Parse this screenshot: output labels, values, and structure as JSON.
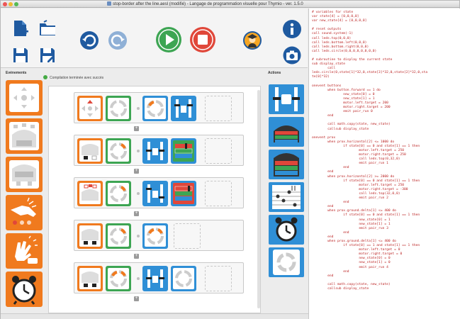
{
  "window": {
    "title": "stop-border after the line.aesl (modifié) - Langage de programmation visuelle pour Thymio - ver. 1.5.0"
  },
  "toolbar": {
    "icons": [
      "new-file-icon",
      "open-folder-icon",
      "save-icon",
      "save-as-icon",
      "undo-icon",
      "redo-icon",
      "run-icon",
      "stop-icon",
      "advanced-mode-icon",
      "info-icon",
      "screenshot-icon"
    ]
  },
  "events_panel": {
    "title": "Evénements",
    "items": [
      "buttons-event",
      "proximity-event",
      "ground-event",
      "tap-event",
      "clap-event",
      "timer-event"
    ]
  },
  "actions_panel": {
    "title": "Actions",
    "items": [
      "motors-action",
      "top-color-action",
      "bottom-color-action",
      "music-action",
      "timer-action",
      "state-action"
    ]
  },
  "status": {
    "text": "Compilation terminée avec succès"
  },
  "colors": {
    "orange": "#f07a1e",
    "blue": "#2f8fd6",
    "green": "#3da553",
    "red": "#e0473a",
    "code_red": "#b22222"
  },
  "code": {
    "text": "# variables for state\nvar state[4] = [0,0,0,0]\nvar new_state[4] = [0,0,0,0]\n\n# reset outputs\ncall sound.system(-1)\ncall leds.top(0,0,0)\ncall leds.bottom.left(0,0,0)\ncall leds.bottom.right(0,0,0)\ncall leds.circle(0,0,0,0,0,0,0,0)\n\n# subroutine to display the current state\nsub display_state\n\tcall\nleds.circle(0,state[1]*32,0,state[3]*32,0,state[2]*32,0,sta\nte[0]*32)\n\nonevent buttons\n\twhen button.forward == 1 do\n\t\tnew_state[0] = 0\n\t\tnew_state[1] = 1\n\t\tmotor.left.target = 200\n\t\tmotor.right.target = 200\n\t\temit pair_run 0\n\tend\n\n\tcall math.copy(state, new_state)\n\tcallsub display_state\n\nonevent prox\n\twhen prox.horizontal[2] <= 1000 do\n\t\tif state[0] == 0 and state[1] == 1 then\n\t\t\tmotor.left.target = 250\n\t\t\tmotor.right.target = 250\n\t\t\tcall leds.top(0,32,0)\n\t\t\temit pair_run 1\n\t\tend\n\tend\n\twhen prox.horizontal[2] >= 2000 do\n\t\tif state[0] == 0 and state[1] == 1 then\n\t\t\tmotor.left.target = 250\n\t\t\tmotor.right.target = -300\n\t\t\tcall leds.top(32,0,0)\n\t\t\temit pair_run 2\n\t\tend\n\tend\n\twhen prox.ground.delta[1] <= 400 do\n\t\tif state[0] == 0 and state[1] == 1 then\n\t\t\tnew_state[0] = 1\n\t\t\tnew_state[1] = 1\n\t\t\temit pair_run 3\n\t\tend\n\tend\n\twhen prox.ground.delta[1] <= 400 do\n\t\tif state[0] == 1 and state[1] == 1 then\n\t\t\tmotor.left.target = 0\n\t\t\tmotor.right.target = 0\n\t\t\tnew_state[0] = 0\n\t\t\tnew_state[1] = 0\n\t\t\temit pair_run 4\n\t\tend\n\tend\n\n\tcall math.copy(state, new_state)\n\tcallsub display_state"
  }
}
